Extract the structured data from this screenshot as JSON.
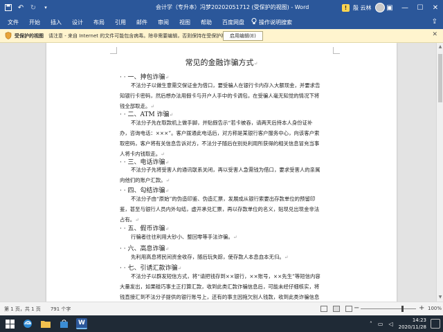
{
  "window": {
    "title": "会计学（专升本）冯梦20202051712 (受保护的视图) - Word",
    "user_name": "殷 云林"
  },
  "ribbon": {
    "tabs": [
      "文件",
      "开始",
      "插入",
      "设计",
      "布局",
      "引用",
      "邮件",
      "审阅",
      "视图",
      "帮助",
      "百度网盘"
    ],
    "tell_me": "操作说明搜索"
  },
  "protected_view": {
    "title": "受保护的视图",
    "message": "请注意 - 来自 Internet 的文件可能包含病毒。除非需要编辑，否则保持在受保护视图中比较安全。",
    "enable_button": "启用编辑(E)"
  },
  "document": {
    "title": "常见的金融诈骗方式",
    "paragraph_mark": "↵",
    "sections": [
      {
        "heading": "一、抻包诈骗",
        "body": "不法分子以做生意需交保证金为借口，要受骗人在银行卡内存入大额现金，并要求告知银行卡密码，然后想办法用假卡与开户人手中的卡调包，在受骗人毫无知觉的情况下将钱全部取走。"
      },
      {
        "heading": "二、ATM 诈骗",
        "body": "不法分子先在取款机上做手脚，并贴假告示“若卡被吞，请两天后持本人身份证补办，咨询电话：×××”。客户拨通此电话后，对方称是某银行客户服务中心，向该客户索取密码，客户将有关信息告诉对方，不法分子随后在别处利用所获得的相关信息冒充当事人将卡内钱取走。"
      },
      {
        "heading": "三、电话诈骗",
        "body": "不法分子先将受害人的通讯联系关闭，再以受害人急需钱为借口，要求受害人的亲属向他们的账户汇款。"
      },
      {
        "heading": "四、勾结诈骗",
        "body": "不法分子由“原始”的伪造印鉴、伪造汇票，发展成从银行索要出存款单位的预留印鉴，甚至与银行人员内外勾结，虚开承兑汇票，再以存款单位的名义，贴现兑出现金非法占有。"
      },
      {
        "heading": "五、假币诈骗",
        "body": "行骗者往往利用大钞小、整回零等手法诈骗。"
      },
      {
        "heading": "六、高息诈骗",
        "body": "先利用高息将民间资金收存，随后玩失踪，使存款人本息血本无归。"
      },
      {
        "heading": "七、引诱汇款诈骗",
        "body": "不法分子以群发短信方式，将“请把钱存到××银行，××账号，××先生”等短信内容大量发出，如果碰巧事主正打算汇款，收到此类汇款诈骗信息后，可能未经仔细核实，将钱直接汇到不法分子提供的银行账号上，还有的事主因拖欠别人钱款，收到此类诈骗信息时，"
      }
    ]
  },
  "status": {
    "page": "第 1 页，共 1 页",
    "words": "791 个字",
    "zoom_minus": "−",
    "zoom_plus": "+",
    "zoom": "100%"
  },
  "taskbar": {
    "time": "14:23",
    "date": "2020/11/28"
  }
}
